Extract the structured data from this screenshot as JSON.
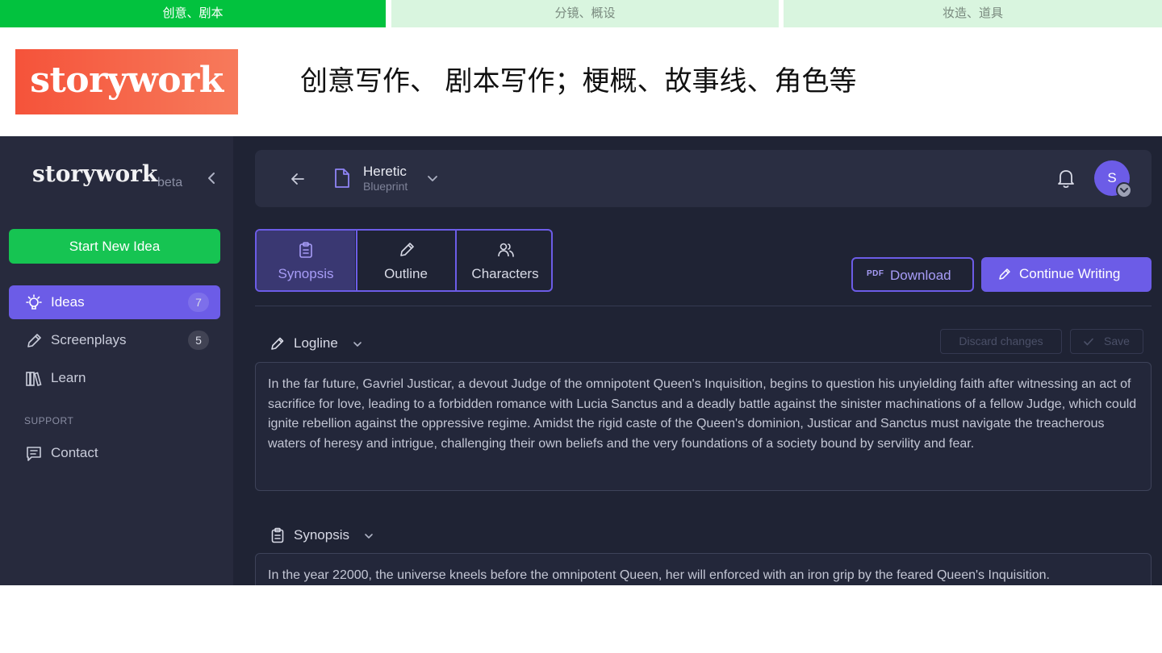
{
  "category_tabs": [
    "创意、剧本",
    "分镜、概设",
    "妆造、道具"
  ],
  "header": {
    "logo_text": "storywork",
    "tagline": "创意写作、 剧本写作；梗概、故事线、角色等"
  },
  "sidebar": {
    "brand": "storywork",
    "badge": "beta",
    "start_button": "Start New Idea",
    "items": [
      {
        "label": "Ideas",
        "count": "7",
        "icon": "lightbulb-icon",
        "active": true
      },
      {
        "label": "Screenplays",
        "count": "5",
        "icon": "pencil-icon",
        "active": false
      },
      {
        "label": "Learn",
        "count": "",
        "icon": "books-icon",
        "active": false
      }
    ],
    "support_label": "SUPPORT",
    "support_items": [
      {
        "label": "Contact",
        "icon": "chat-icon"
      }
    ]
  },
  "topbar": {
    "doc_title": "Heretic",
    "doc_subtitle": "Blueprint",
    "avatar_initial": "S"
  },
  "tabs": [
    {
      "label": "Synopsis",
      "icon": "clipboard-icon",
      "active": true
    },
    {
      "label": "Outline",
      "icon": "pencil-icon",
      "active": false
    },
    {
      "label": "Characters",
      "icon": "users-icon",
      "active": false
    }
  ],
  "actions": {
    "pdf_tag": "PDF",
    "download": "Download",
    "continue": "Continue Writing",
    "discard": "Discard changes",
    "save": "Save"
  },
  "logline": {
    "heading": "Logline",
    "text": "In the far future, Gavriel Justicar, a devout Judge of the omnipotent Queen's Inquisition, begins to question his unyielding faith after witnessing an act of sacrifice for love, leading to a forbidden romance with Lucia Sanctus and a deadly battle against the sinister machinations of a fellow Judge, which could ignite rebellion against the oppressive regime. Amidst the rigid caste of the Queen's dominion, Justicar and Sanctus must navigate the treacherous waters of heresy and intrigue, challenging their own beliefs and the very foundations of a society bound by servility and fear."
  },
  "synopsis": {
    "heading": "Synopsis",
    "text": "In the year 22000, the universe kneels before the omnipotent Queen, her will enforced with an iron grip by the feared Queen's Inquisition."
  },
  "colors": {
    "accent": "#6c5ce7",
    "green": "#16c452",
    "app_bg": "#1f2334",
    "sidebar_bg": "#272a3d"
  }
}
